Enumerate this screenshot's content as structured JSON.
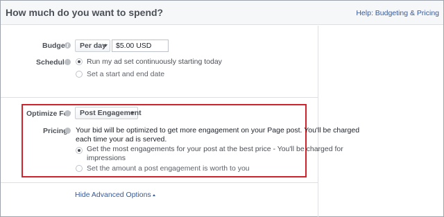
{
  "header": {
    "title": "How much do you want to spend?",
    "help_link": "Help: Budgeting & Pricing"
  },
  "budget": {
    "label": "Budget",
    "period_selected": "Per day",
    "amount_value": "$5.00 USD"
  },
  "schedule": {
    "label": "Schedule",
    "options": [
      {
        "label": "Run my ad set continuously starting today",
        "selected": true
      },
      {
        "label": "Set a start and end date",
        "selected": false
      }
    ]
  },
  "optimize": {
    "label": "Optimize For",
    "selected": "Post Engagement"
  },
  "pricing": {
    "label": "Pricing",
    "description_line1": "Your bid will be optimized to get more engagement on your Page post. You'll be charged",
    "description_line2": "each time your ad is served.",
    "options": [
      {
        "label_line1": "Get the most engagements for your post at the best price - You'll be charged for",
        "label_line2": "impressions",
        "selected": true
      },
      {
        "label_line1": "Set the amount a post engagement is worth to you",
        "selected": false
      }
    ]
  },
  "advanced": {
    "toggle_label": "Hide Advanced Options"
  },
  "colors": {
    "highlight": "#d0222b",
    "link": "#365899"
  }
}
